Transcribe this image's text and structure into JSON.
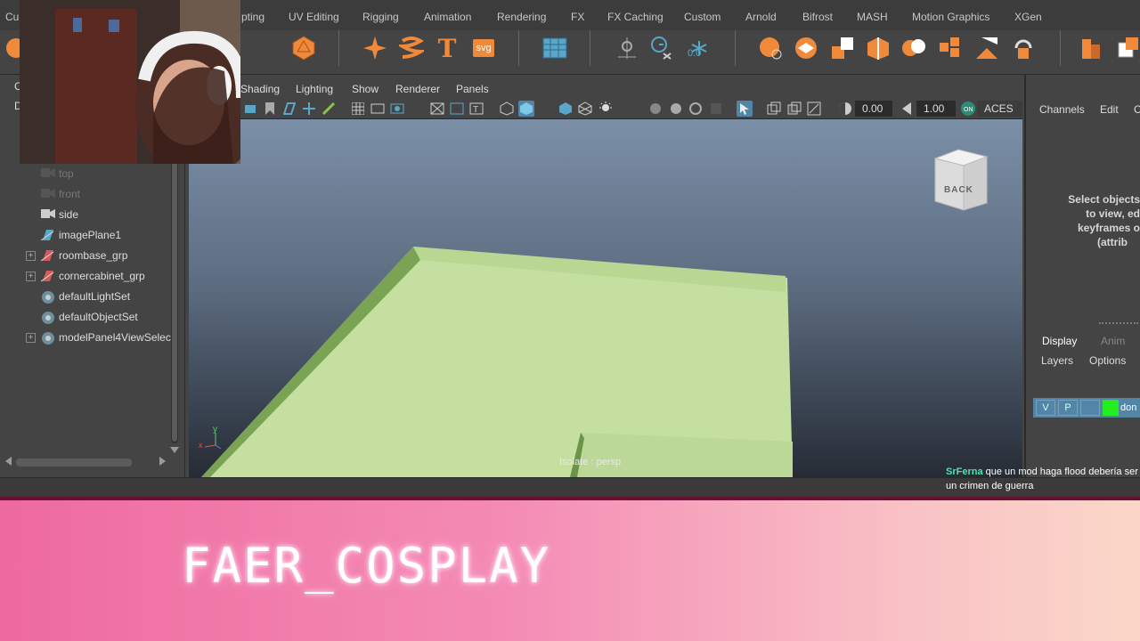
{
  "shelf": {
    "tabs": [
      "Cu",
      "pting",
      "UV Editing",
      "Rigging",
      "Animation",
      "Rendering",
      "FX",
      "FX Caching",
      "Custom",
      "Arnold",
      "Bifrost",
      "MASH",
      "Motion Graphics",
      "XGen"
    ],
    "svg_label": "svg",
    "text_label": "T",
    "snow_value": "0.0"
  },
  "viewport_menu": [
    "Shading",
    "Lighting",
    "Show",
    "Renderer",
    "Panels"
  ],
  "viewport_toolbar": {
    "exposure": "0.00",
    "gamma": "1.00",
    "color_space": "ACES 1."
  },
  "outliner": {
    "clipped_letters": [
      "C",
      "D"
    ],
    "items": [
      {
        "label": "top",
        "dim": true
      },
      {
        "label": "front",
        "dim": true
      },
      {
        "label": "side",
        "dim": false
      },
      {
        "label": "imagePlane1",
        "dim": false
      },
      {
        "label": "roombase_grp",
        "dim": false,
        "expandable": true
      },
      {
        "label": "cornercabinet_grp",
        "dim": false,
        "expandable": true
      },
      {
        "label": "defaultLightSet",
        "dim": false
      },
      {
        "label": "defaultObjectSet",
        "dim": false
      },
      {
        "label": "modelPanel4ViewSelec",
        "dim": false,
        "expandable": true
      }
    ]
  },
  "viewport": {
    "viewcube_label": "BACK",
    "isolate_text": "Isolate : persp",
    "axis_y": "y",
    "axis_x": "x"
  },
  "channel_box": {
    "tabs": [
      "Channels",
      "Edit",
      "C"
    ],
    "message_lines": [
      "Select objects",
      "to view, ed",
      "keyframes o",
      "(attrib"
    ],
    "layer_tabs": [
      "Display",
      "Anim"
    ],
    "layer_subtabs": [
      "Layers",
      "Options"
    ],
    "layer_buttons": [
      "V",
      "P",
      ""
    ],
    "layer_name": "don"
  },
  "chat": {
    "user": "SrFerna",
    "message": "que un mod haga flood debería ser un crimen de guerra"
  },
  "banner": {
    "channel_name": "FAER_COSPLAY"
  }
}
